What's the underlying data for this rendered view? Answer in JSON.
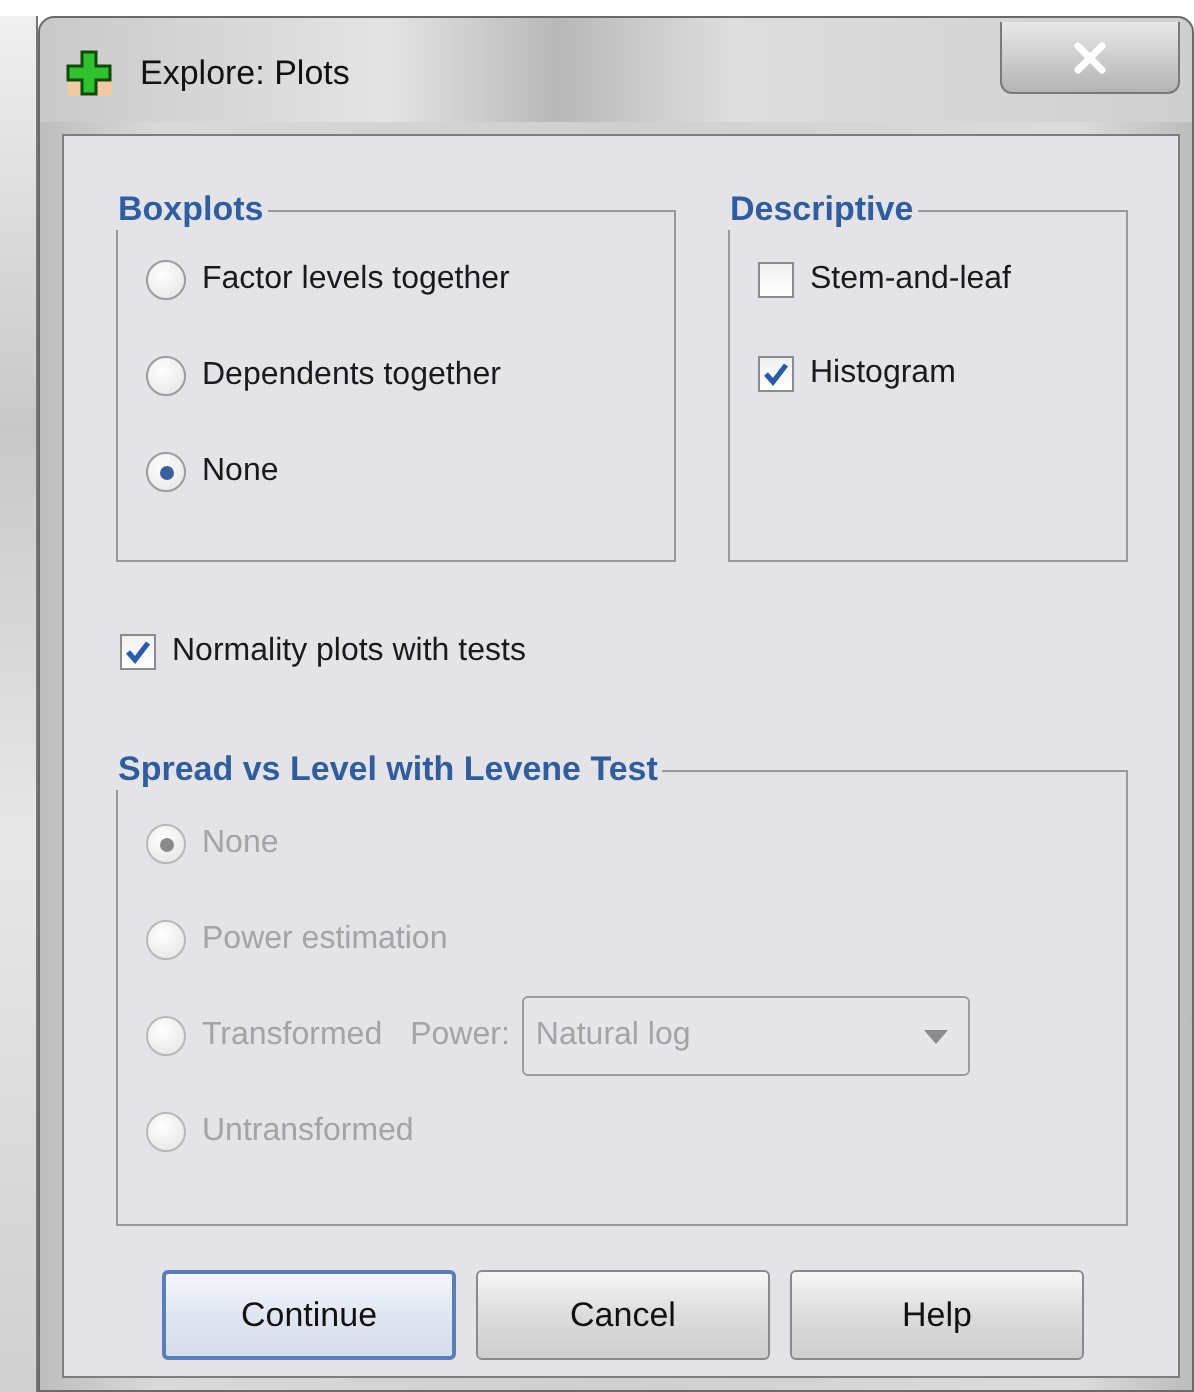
{
  "window": {
    "title": "Explore: Plots"
  },
  "boxplots": {
    "title": "Boxplots",
    "options": [
      {
        "label": "Factor levels together",
        "selected": false
      },
      {
        "label": "Dependents together",
        "selected": false
      },
      {
        "label": "None",
        "selected": true
      }
    ]
  },
  "descriptive": {
    "title": "Descriptive",
    "options": [
      {
        "label": "Stem-and-leaf",
        "checked": false
      },
      {
        "label": "Histogram",
        "checked": true
      }
    ]
  },
  "normality": {
    "label": "Normality plots with tests",
    "checked": true
  },
  "spread": {
    "title": "Spread vs Level with Levene Test",
    "disabled": true,
    "options": [
      {
        "label": "None",
        "selected": true
      },
      {
        "label": "Power estimation",
        "selected": false
      },
      {
        "label": "Transformed",
        "selected": false,
        "power": {
          "label": "Power:",
          "value": "Natural log"
        }
      },
      {
        "label": "Untransformed",
        "selected": false
      }
    ]
  },
  "buttons": [
    {
      "label": "Continue",
      "default": true
    },
    {
      "label": "Cancel",
      "default": false
    },
    {
      "label": "Help",
      "default": false
    }
  ]
}
